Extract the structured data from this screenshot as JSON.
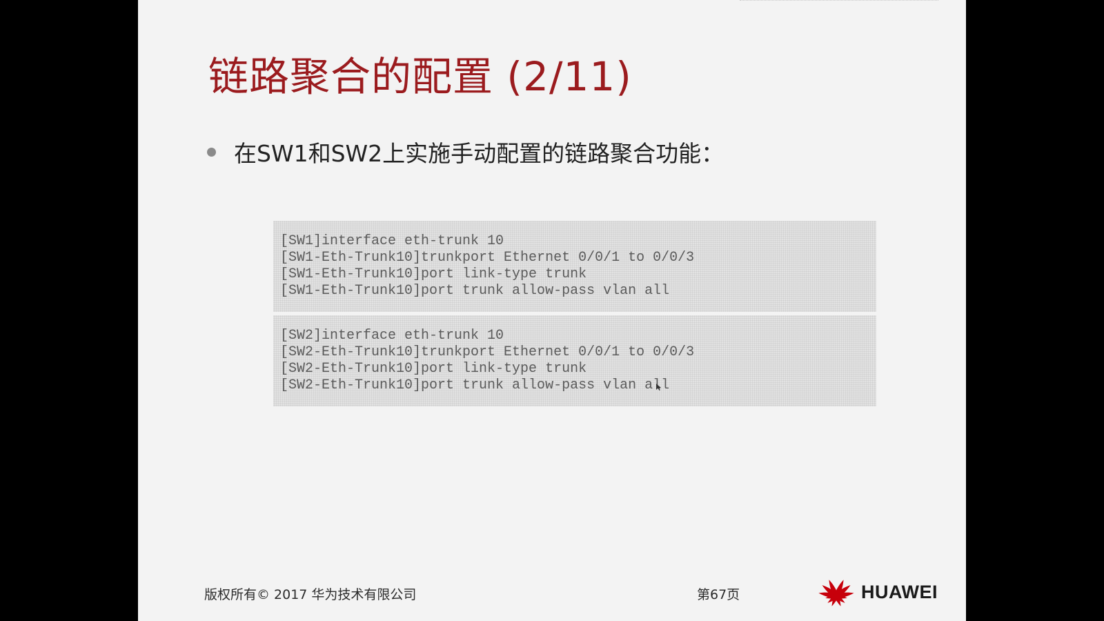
{
  "slide": {
    "title": "链路聚合的配置 (2/11)",
    "bullet_text": "在SW1和SW2上实施手动配置的链路聚合功能：",
    "code_blocks": [
      {
        "lines": [
          "[SW1]interface eth-trunk 10",
          "[SW1-Eth-Trunk10]trunkport Ethernet 0/0/1 to 0/0/3",
          "[SW1-Eth-Trunk10]port link-type trunk",
          "[SW1-Eth-Trunk10]port trunk allow-pass vlan all"
        ]
      },
      {
        "lines": [
          "[SW2]interface eth-trunk 10",
          "[SW2-Eth-Trunk10]trunkport Ethernet 0/0/1 to 0/0/3",
          "[SW2-Eth-Trunk10]port link-type trunk",
          "[SW2-Eth-Trunk10]port trunk allow-pass vlan all"
        ]
      }
    ]
  },
  "footer": {
    "copyright": "版权所有© 2017 华为技术有限公司",
    "page_number": "第67页"
  },
  "logo": {
    "text": "HUAWEI",
    "icon": "huawei-petal-logo",
    "color": "#c7000b"
  },
  "colors": {
    "title": "#9b1b1e",
    "slide_background": "#f3f3f3",
    "letterbox": "#000000",
    "code_background": "#e2e2e2"
  }
}
